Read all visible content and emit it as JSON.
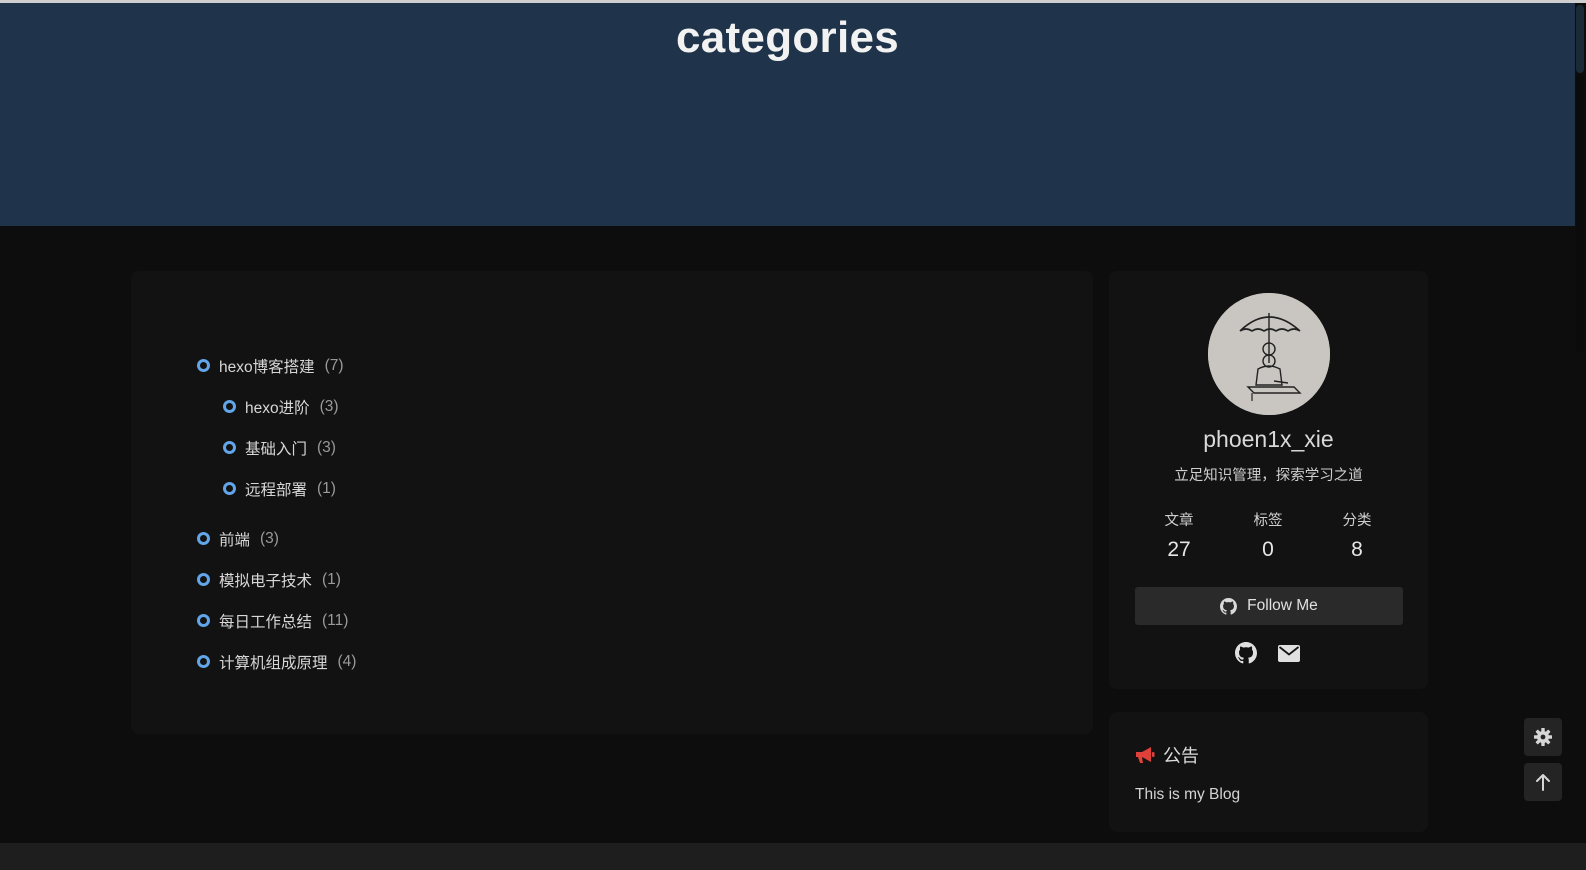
{
  "page": {
    "title": "categories"
  },
  "categories": [
    {
      "name": "hexo博客搭建",
      "count": "(7)",
      "level": 0
    },
    {
      "name": "hexo进阶",
      "count": "(3)",
      "level": 1
    },
    {
      "name": "基础入门",
      "count": "(3)",
      "level": 1
    },
    {
      "name": "远程部署",
      "count": "(1)",
      "level": 1
    },
    {
      "name": "前端",
      "count": "(3)",
      "level": 0
    },
    {
      "name": "模拟电子技术",
      "count": "(1)",
      "level": 0
    },
    {
      "name": "每日工作总结",
      "count": "(11)",
      "level": 0
    },
    {
      "name": "计算机组成原理",
      "count": "(4)",
      "level": 0
    }
  ],
  "author": {
    "name": "phoen1x_xie",
    "description": "立足知识管理，探索学习之道",
    "stats": [
      {
        "label": "文章",
        "value": "27"
      },
      {
        "label": "标签",
        "value": "0"
      },
      {
        "label": "分类",
        "value": "8"
      }
    ],
    "follow_label": "Follow Me",
    "follow_icon": "github-icon",
    "social_icons": [
      "github-icon",
      "envelope-icon"
    ]
  },
  "notice": {
    "title": "公告",
    "icon": "bullhorn-icon",
    "text": "This is my Blog"
  },
  "floating": {
    "icons": [
      "gear-icon",
      "arrow-up-icon"
    ]
  },
  "colors": {
    "header_bg": "#1f344a",
    "accent_dot": "#62a5e8",
    "notice_icon": "#e0403a",
    "card_bg": "#121212",
    "page_bg": "#0d0d0d"
  }
}
